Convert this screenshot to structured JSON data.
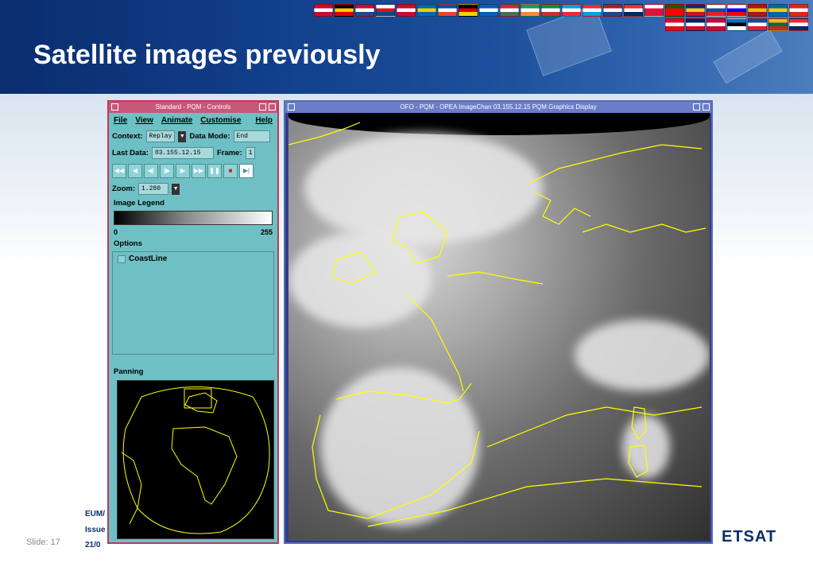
{
  "slide": {
    "title": "Satellite images previously",
    "slide_label": "Slide: 17",
    "doc_ref": "EUM/",
    "issue": "Issue",
    "date": "21/0",
    "logo_text": "ETSAT",
    "brand_color": "#0b2d6b"
  },
  "controls_window": {
    "title": "Standard - PQM - Controls",
    "menu": [
      "File",
      "View",
      "Animate",
      "Customise",
      "Help"
    ],
    "context_label": "Context:",
    "context_value": "Replay",
    "data_mode_label": "Data Mode:",
    "data_mode_value": "End",
    "last_data_label": "Last Data:",
    "last_data_value": "03.155.12.15",
    "frame_label": "Frame:",
    "frame_value": "1",
    "zoom_label": "Zoom:",
    "zoom_value": "1.280",
    "legend_title": "Image Legend",
    "legend_min": "0",
    "legend_max": "255",
    "options_title": "Options",
    "coastline_label": "CoastLine",
    "panning_title": "Panning",
    "playback_icons": [
      "rewind-icon",
      "step-back-icon",
      "play-back-icon",
      "slow-back-icon",
      "play-icon",
      "fast-forward-icon",
      "pause-icon",
      "stop-icon",
      "end-icon"
    ]
  },
  "graphics_window": {
    "title": "OFO - PQM - OPEA ImageChan 03.155.12.15 PQM Graphics Display",
    "coast_color": "#ffff00"
  }
}
